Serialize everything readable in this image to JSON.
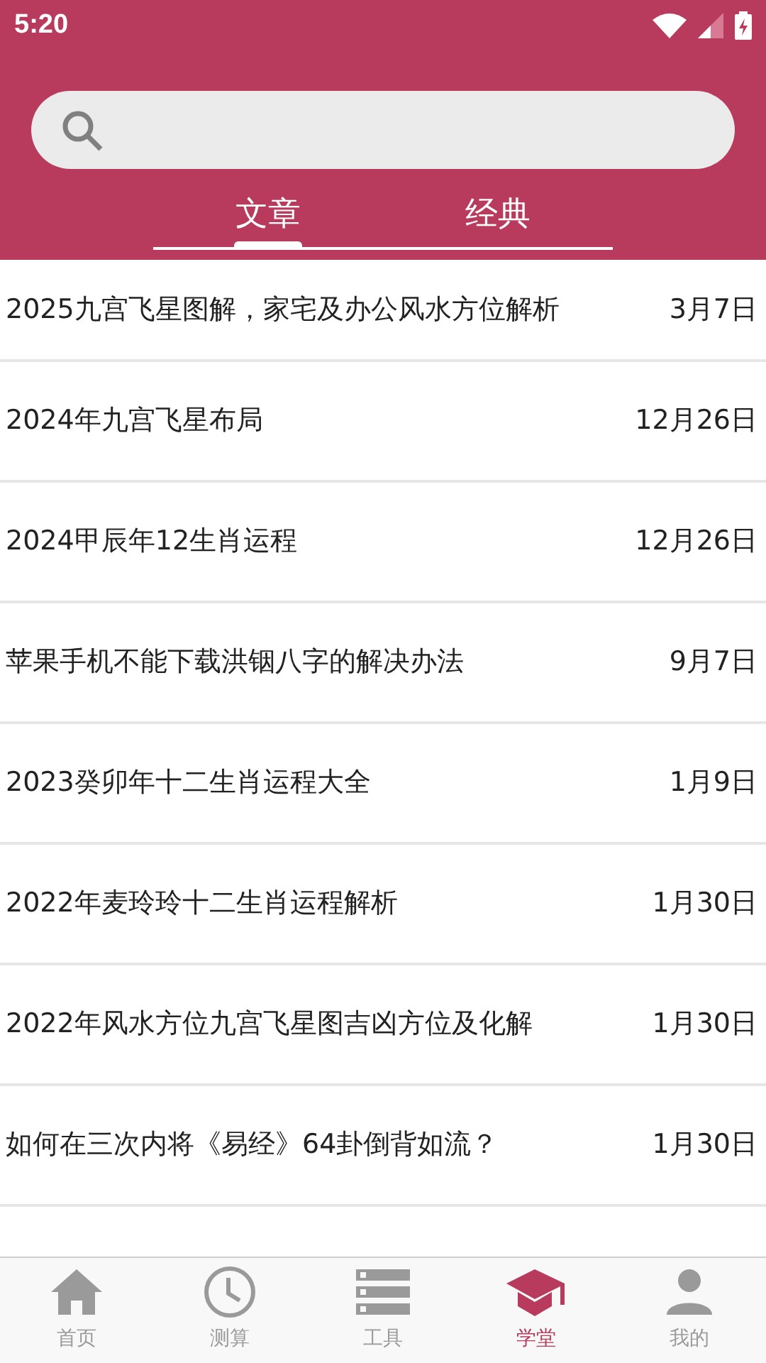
{
  "status_bar": {
    "time": "5:20"
  },
  "tabs": [
    {
      "label": "文章",
      "selected": true
    },
    {
      "label": "经典",
      "selected": false
    }
  ],
  "articles": [
    {
      "title": "2025九宫飞星图解，家宅及办公风水方位解析",
      "date": "3月7日"
    },
    {
      "title": "2024年九宫飞星布局",
      "date": "12月26日"
    },
    {
      "title": "2024甲辰年12生肖运程",
      "date": "12月26日"
    },
    {
      "title": "苹果手机不能下载洪铟八字的解决办法",
      "date": "9月7日"
    },
    {
      "title": "2023癸卯年十二生肖运程大全",
      "date": "1月9日"
    },
    {
      "title": "2022年麦玲玲十二生肖运程解析",
      "date": "1月30日"
    },
    {
      "title": "2022年风水方位九宫飞星图吉凶方位及化解",
      "date": "1月30日"
    },
    {
      "title": "如何在三次内将《易经》64卦倒背如流？",
      "date": "1月30日"
    }
  ],
  "bottom_nav": [
    {
      "label": "首页",
      "kind": "home",
      "selected": false
    },
    {
      "label": "测算",
      "kind": "clock",
      "selected": false
    },
    {
      "label": "工具",
      "kind": "list",
      "selected": false
    },
    {
      "label": "学堂",
      "kind": "school",
      "selected": true
    },
    {
      "label": "我的",
      "kind": "person",
      "selected": false
    }
  ]
}
